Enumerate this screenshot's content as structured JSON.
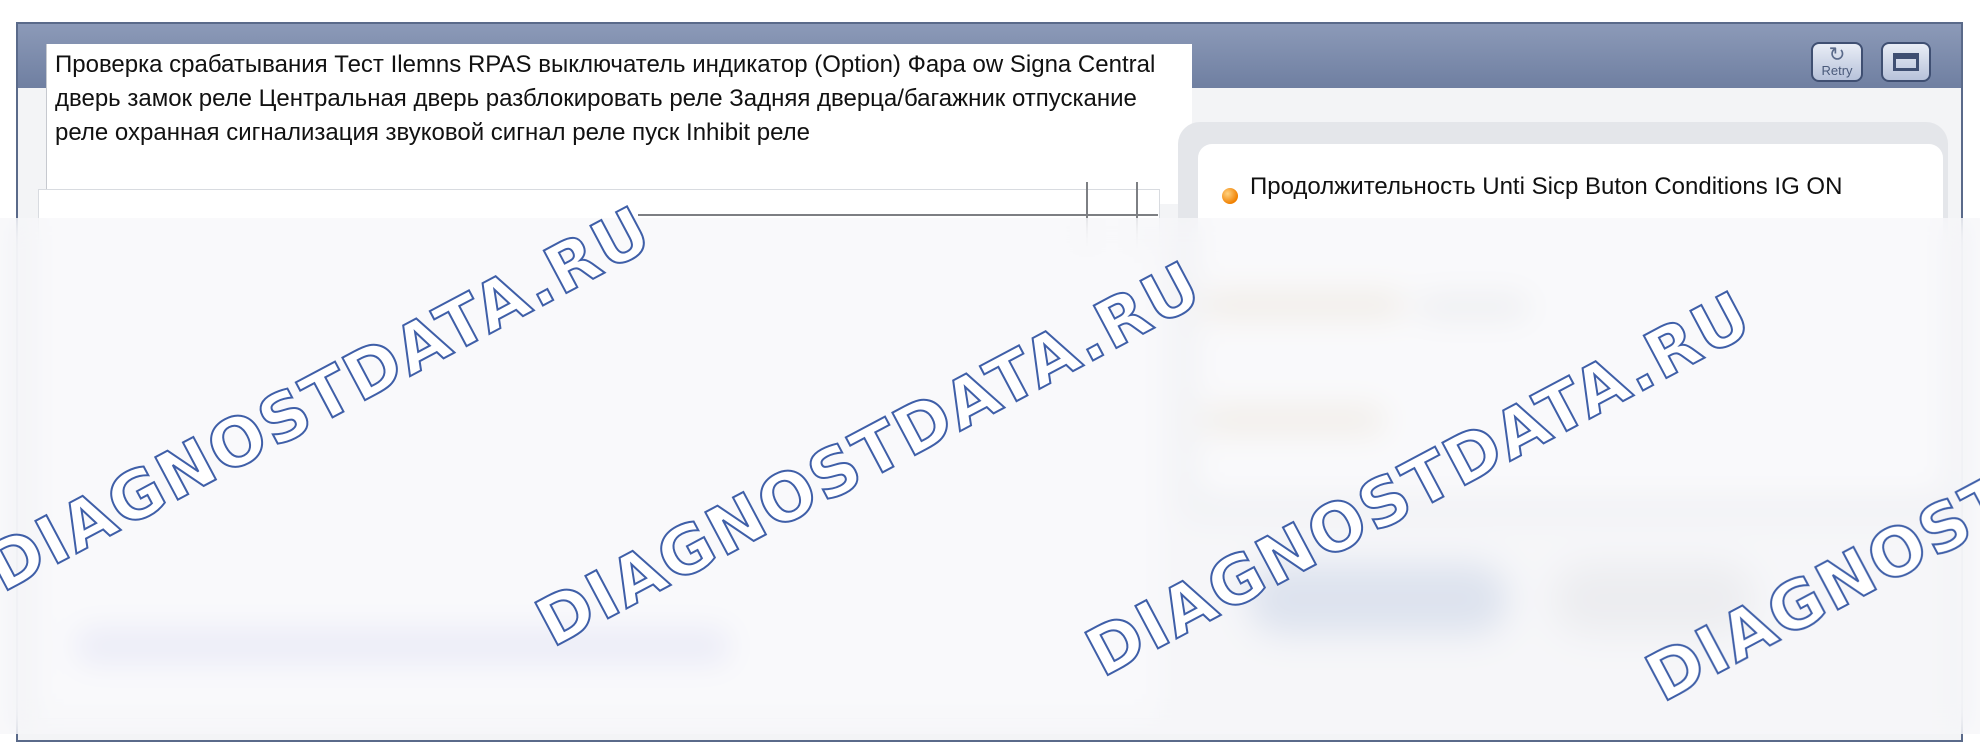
{
  "toolbar": {
    "retry_label": "Retry"
  },
  "description": "Проверка срабатывания Тест Ilemns RPAS выключатель индикатор (Option) Фара ow Signa Central дверь замок реле Центральная дверь разблокировать реле Задняя дверца/багажник отпускание реле охранная сигнализация звуковой сигнал реле пуск Inhibit реле",
  "conditions": {
    "text": "Продолжительность Unti Sicp Buton Conditions IG ON"
  },
  "watermark": {
    "text": "DIAGNOSTDATA.RU"
  },
  "icons": {
    "retry": "retry-icon",
    "window": "window-icon",
    "status": "status-dot-icon"
  },
  "colors": {
    "titlebar": "#7a89aa",
    "accent_orange": "#f08000",
    "watermark_outline": "#3f5fa8"
  }
}
